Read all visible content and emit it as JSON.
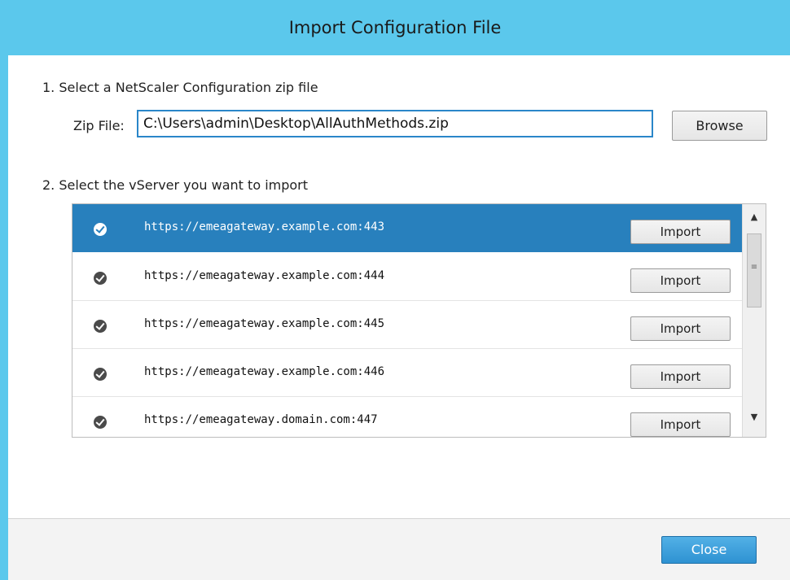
{
  "dialog": {
    "title": "Import Configuration File"
  },
  "step1": {
    "label": "1. Select a NetScaler Configuration zip file",
    "zip_label": "Zip File:",
    "zip_value": "C:\\Users\\admin\\Desktop\\AllAuthMethods.zip",
    "browse_label": "Browse"
  },
  "step2": {
    "label": "2. Select the vServer you want to import",
    "items": [
      {
        "url": "https://emeagateway.example.com:443",
        "button": "Import",
        "selected": true
      },
      {
        "url": "https://emeagateway.example.com:444",
        "button": "Import",
        "selected": false
      },
      {
        "url": "https://emeagateway.example.com:445",
        "button": "Import",
        "selected": false
      },
      {
        "url": "https://emeagateway.example.com:446",
        "button": "Import",
        "selected": false
      },
      {
        "url": "https://emeagateway.domain.com:447",
        "button": "Import",
        "selected": false
      }
    ]
  },
  "footer": {
    "close_label": "Close"
  },
  "colors": {
    "accent": "#5bc8ec",
    "selection": "#2880bd",
    "primary_button": "#3a9fdb"
  },
  "icons": {
    "row_status": "check-circle-icon",
    "scroll_up": "triangle-up-icon",
    "scroll_down": "triangle-down-icon"
  }
}
